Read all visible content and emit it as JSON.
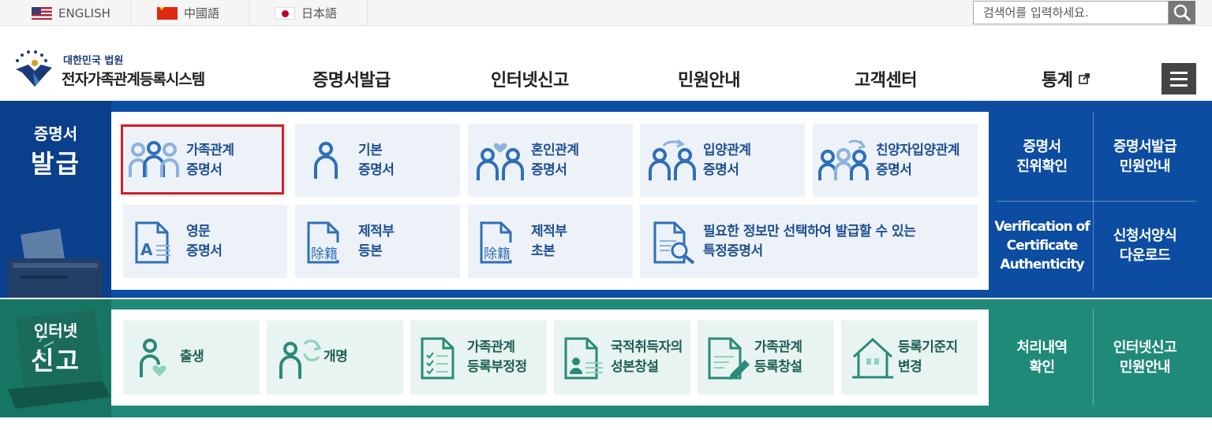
{
  "languages": [
    {
      "label": "ENGLISH",
      "flag": "us-flag-icon"
    },
    {
      "label": "中國語",
      "flag": "cn-flag-icon"
    },
    {
      "label": "日本語",
      "flag": "jp-flag-icon"
    }
  ],
  "search": {
    "placeholder": "검색어를 입력하세요."
  },
  "logo": {
    "subtitle": "대한민국 법원",
    "title": "전자가족관계등록시스템"
  },
  "nav": [
    "증명서발급",
    "인터넷신고",
    "민원안내",
    "고객센터",
    "통계"
  ],
  "certificate": {
    "side_line1": "증명서",
    "side_line2": "발급",
    "tiles": [
      {
        "line1": "가족관계",
        "line2": "증명서",
        "icon": "family-three-people-icon"
      },
      {
        "line1": "기본",
        "line2": "증명서",
        "icon": "person-icon"
      },
      {
        "line1": "혼인관계",
        "line2": "증명서",
        "icon": "couple-heart-icon"
      },
      {
        "line1": "입양관계",
        "line2": "증명서",
        "icon": "couple-arrow-icon"
      },
      {
        "line1": "친양자입양관계",
        "line2": "증명서",
        "icon": "family-arrow-icon"
      },
      {
        "line1": "영문",
        "line2": "증명서",
        "icon": "english-document-icon"
      },
      {
        "line1": "제적부",
        "line2": "등본",
        "icon": "removed-register-document-icon",
        "stamp": "除籍"
      },
      {
        "line1": "제적부",
        "line2": "초본",
        "icon": "removed-register-document-icon",
        "stamp": "除籍"
      },
      {
        "line1": "필요한 정보만 선택하여 발급할 수 있는",
        "line2": "특정증명서",
        "icon": "document-search-icon"
      }
    ],
    "links": [
      {
        "line1": "증명서",
        "line2": "진위확인"
      },
      {
        "line1": "증명서발급",
        "line2": "민원안내"
      },
      {
        "line1": "Verification of",
        "line2": "Certificate",
        "line3": "Authenticity"
      },
      {
        "line1": "신청서양식",
        "line2": "다운로드"
      }
    ]
  },
  "report": {
    "side_line1": "인터넷",
    "side_line2": "신고",
    "tiles": [
      {
        "line1": "출생",
        "icon": "baby-heart-icon"
      },
      {
        "line1": "개명",
        "icon": "person-refresh-icon"
      },
      {
        "line1": "가족관계",
        "line2": "등록부정정",
        "icon": "checklist-document-icon"
      },
      {
        "line1": "국적취득자의",
        "line2": "성본창설",
        "icon": "id-document-icon"
      },
      {
        "line1": "가족관계",
        "line2": "등록창설",
        "icon": "document-pen-icon"
      },
      {
        "line1": "등록기준지",
        "line2": "변경",
        "icon": "house-icon"
      }
    ],
    "links": [
      {
        "line1": "처리내역",
        "line2": "확인"
      },
      {
        "line1": "인터넷신고",
        "line2": "민원안내"
      }
    ]
  }
}
